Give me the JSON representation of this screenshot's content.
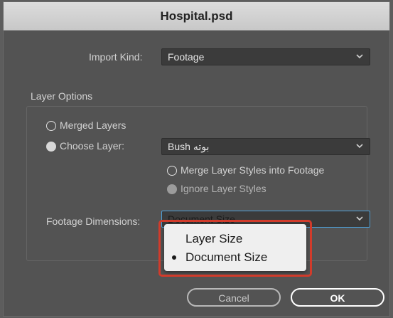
{
  "window": {
    "title": "Hospital.psd"
  },
  "import_kind": {
    "label": "Import Kind:",
    "value": "Footage"
  },
  "layer_options": {
    "group_label": "Layer Options",
    "merged_layers_label": "Merged Layers",
    "merged_layers_selected": false,
    "choose_layer_label": "Choose Layer:",
    "choose_layer_selected": true,
    "layer_value": "Bush بوته",
    "merge_styles_label": "Merge Layer Styles into Footage",
    "merge_styles_selected": false,
    "ignore_styles_label": "Ignore Layer Styles",
    "ignore_styles_selected": true
  },
  "footage_dimensions": {
    "label": "Footage Dimensions:",
    "value": "Document Size",
    "menu": [
      {
        "label": "Layer Size",
        "selected": false
      },
      {
        "label": "Document Size",
        "selected": true
      }
    ]
  },
  "buttons": {
    "cancel": "Cancel",
    "ok": "OK"
  },
  "colors": {
    "dialog_bg": "#535353",
    "field_bg": "#3b3b3b",
    "focus_border": "#4ea0d8",
    "highlight_box": "#d13b2b",
    "menu_bg": "#efefef"
  },
  "icons": {
    "dropdown": "chevron-down-icon",
    "selected_menu_item": "bullet-icon"
  }
}
